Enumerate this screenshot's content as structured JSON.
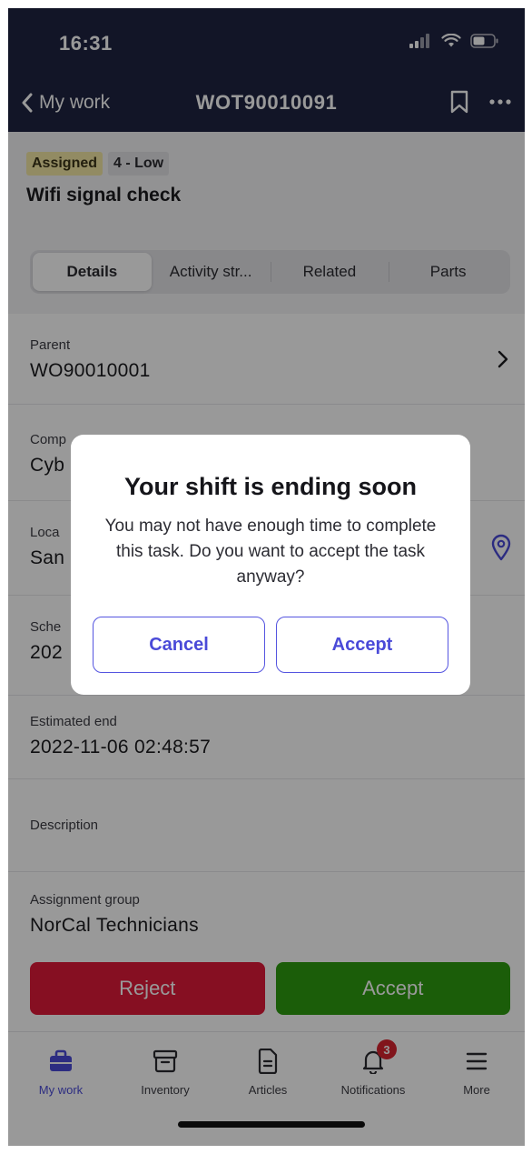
{
  "status_bar": {
    "time": "16:31"
  },
  "nav": {
    "back_label": "My work",
    "title": "WOT90010091"
  },
  "task": {
    "status_badge": "Assigned",
    "priority_badge": "4 - Low",
    "title": "Wifi signal check"
  },
  "tabs": [
    {
      "label": "Details"
    },
    {
      "label": "Activity str..."
    },
    {
      "label": "Related"
    },
    {
      "label": "Parts"
    }
  ],
  "fields": {
    "parent": {
      "label": "Parent",
      "value": "WO90010001"
    },
    "company": {
      "label": "Comp",
      "value": "Cyb"
    },
    "location": {
      "label": "Loca",
      "value": "San"
    },
    "scheduled": {
      "label": "Sche",
      "value": "202"
    },
    "estimated_end": {
      "label": "Estimated end",
      "value": "2022-11-06 02:48:57"
    },
    "description": {
      "label": "Description",
      "value": ""
    },
    "assignment_group": {
      "label": "Assignment group",
      "value": "NorCal Technicians"
    }
  },
  "actions": {
    "reject": "Reject",
    "accept": "Accept"
  },
  "tabbar": {
    "items": [
      {
        "label": "My work",
        "icon": "briefcase-icon"
      },
      {
        "label": "Inventory",
        "icon": "archive-box-icon"
      },
      {
        "label": "Articles",
        "icon": "document-icon"
      },
      {
        "label": "Notifications",
        "icon": "bell-icon",
        "count": "3"
      },
      {
        "label": "More",
        "icon": "hamburger-menu-icon"
      }
    ]
  },
  "dialog": {
    "title": "Your shift is ending soon",
    "message": "You may not have enough time to complete this task. Do you want to accept the task anyway?",
    "cancel": "Cancel",
    "accept": "Accept"
  },
  "colors": {
    "nav_bg": "#1f2442",
    "accent": "#4a4ad8",
    "reject": "#e0193a",
    "accept": "#2d9c10",
    "assigned_badge": "#f4e8a6"
  }
}
